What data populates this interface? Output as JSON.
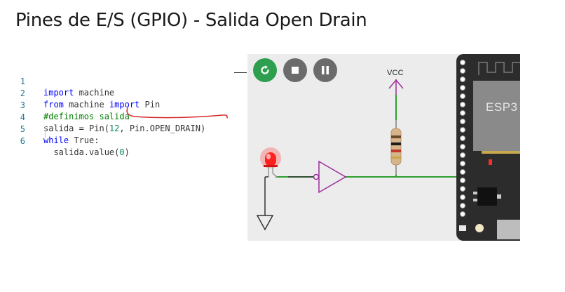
{
  "slide": {
    "title": "Pines de E/S (GPIO) - Salida Open Drain"
  },
  "editor": {
    "lines": [
      {
        "num": "1",
        "text": "import machine"
      },
      {
        "num": "2",
        "text": "from machine import Pin"
      },
      {
        "num": "3",
        "text": "#definimos salida"
      },
      {
        "num": "4",
        "text": "salida = Pin(12, Pin.OPEN_DRAIN)"
      },
      {
        "num": "5",
        "text": "while True:"
      },
      {
        "num": "6",
        "text": "  salida.value(0)"
      }
    ]
  },
  "simulator": {
    "controls": [
      {
        "name": "restart",
        "icon": "restart-icon",
        "color": "#2e9e4f"
      },
      {
        "name": "stop",
        "icon": "stop-icon",
        "color": "#6b6b6b"
      },
      {
        "name": "pause",
        "icon": "pause-icon",
        "color": "#6b6b6b"
      }
    ],
    "vcc_label": "VCC",
    "board_label": "ESP3",
    "colors": {
      "wire": "#2e9e2e",
      "gate": "#9b2d9b",
      "led": "#ff2020",
      "board": "#2c2c2c",
      "canvas": "#ececec"
    }
  }
}
